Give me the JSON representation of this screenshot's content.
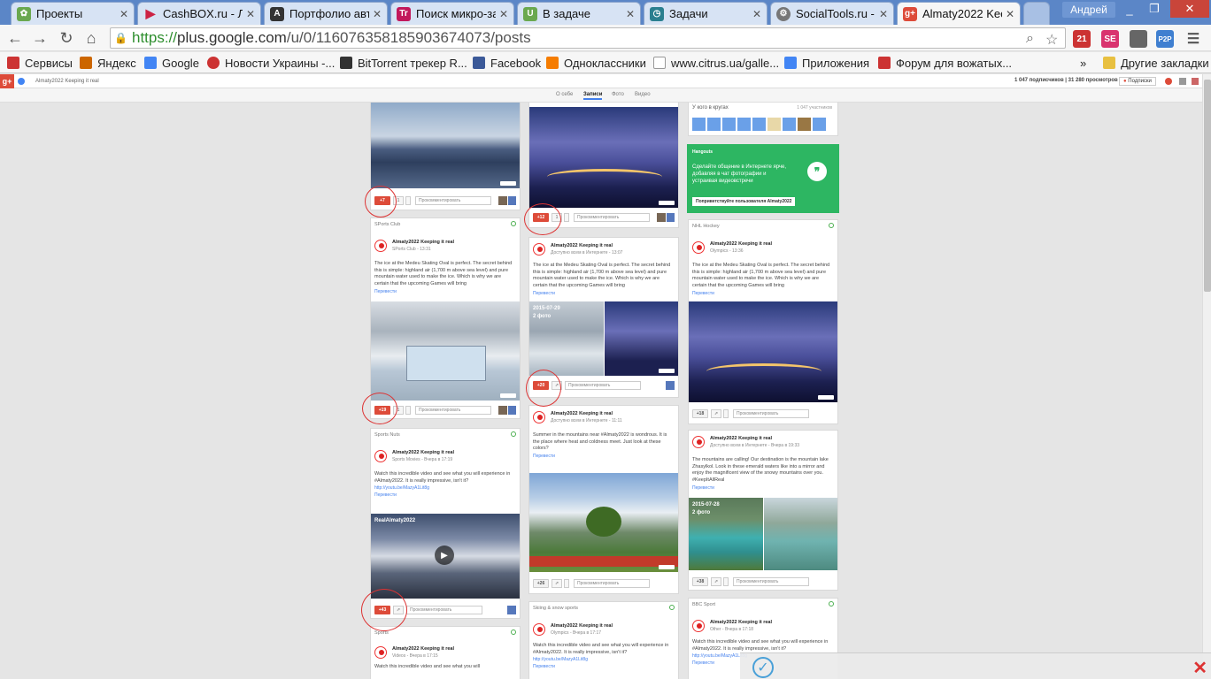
{
  "tabs": [
    {
      "title": "Проекты",
      "icon": "projects-icon",
      "color": "#6aa84f"
    },
    {
      "title": "CashBOX.ru - Ли",
      "icon": "cashbox-icon",
      "color": "#cc2244"
    },
    {
      "title": "Портфолио авто",
      "icon": "portfolio-icon",
      "color": "#333333"
    },
    {
      "title": "Поиск микро-за",
      "icon": "search-micro-icon",
      "color": "#c2185b"
    },
    {
      "title": "В задаче",
      "icon": "task-icon",
      "color": "#6aa84f"
    },
    {
      "title": "Задачи",
      "icon": "tasks-icon",
      "color": "#2a7f8f"
    },
    {
      "title": "SocialTools.ru -",
      "icon": "socialtools-icon",
      "color": "#555555"
    },
    {
      "title": "Almaty2022 Kee",
      "icon": "gplus-icon",
      "color": "#dd4b39"
    }
  ],
  "window": {
    "user": "Андрей"
  },
  "address": {
    "scheme": "https://",
    "host": "plus.google.com",
    "path": "/u/0/116076358185903674073/posts"
  },
  "extensions": [
    {
      "label": "21",
      "color": "#cc3333"
    },
    {
      "label": "SE",
      "color": "#d9336f"
    },
    {
      "label": "",
      "color": "#666666"
    },
    {
      "label": "P2P",
      "color": "#3f7fd0"
    },
    {
      "label": "",
      "color": "#555555"
    }
  ],
  "bookmarks": [
    {
      "label": "Сервисы",
      "color": "#cc3333"
    },
    {
      "label": "Яндекс",
      "color": "#cc6600"
    },
    {
      "label": "Google",
      "color": "#4285f4"
    },
    {
      "label": "Новости Украины -...",
      "color": "#cc3333"
    },
    {
      "label": "BitTorrent трекер R...",
      "color": "#333333"
    },
    {
      "label": "Facebook",
      "color": "#3b5998"
    },
    {
      "label": "Одноклассники",
      "color": "#f57c00"
    },
    {
      "label": "www.citrus.ua/galle...",
      "color": "#dddddd"
    },
    {
      "label": "Приложения",
      "color": "#4285f4"
    },
    {
      "label": "Форум для вожатых...",
      "color": "#cc3333"
    }
  ],
  "bookmarks_more": "»",
  "bookmarks_other": "Другие закладки",
  "gbar": {
    "page_name": "Almaty2022 Keeping it real",
    "stats": "1 047 подписчиков | 31 280 просмотров",
    "follow_label": "Подписки"
  },
  "subnav": {
    "tabs": [
      "О себе",
      "Записи",
      "Фото",
      "Видео"
    ],
    "active": 1
  },
  "columns": {
    "left": {
      "top_card": {
        "plus": "+7",
        "comment_ph": "Прокомментировать"
      },
      "card2": {
        "community": "SPorts Club",
        "author": "Almaty2022 Keeping it real",
        "meta": "SPorts Club  -  13:31",
        "text": "The ice at the Medeu Skating Oval is perfect. The secret behind this is simple: highland air (1,700 m above sea level) and pure mountain water used to make the ice. Which is why we are certain that the upcoming Games will bring",
        "translate": "Перевести",
        "plus": "+19",
        "comment_ph": "Прокомментировать"
      },
      "card3": {
        "community": "Sports Nuts",
        "author": "Almaty2022 Keeping it real",
        "meta": "Sports Movies  -  Вчера в 17:19",
        "text": "Watch this incredible video and see what you will experience in #Almaty2022. It is really impressive, isn't it?",
        "link": "http://youtu.be/MazyA1Lit8g",
        "translate": "Перевести",
        "video_title": "RealAlmaty2022",
        "plus": "+43",
        "comment_ph": "Прокомментировать"
      },
      "card4": {
        "community": "Sports",
        "author": "Almaty2022 Keeping it real",
        "meta": "Videos  -  Вчера в 17:15",
        "text": "Watch this incredible video and see what you will"
      }
    },
    "middle": {
      "top_card": {
        "plus": "+12",
        "comment_ph": "Прокомментировать"
      },
      "card2": {
        "author": "Almaty2022 Keeping it real",
        "meta": "Доступно всем в Интернете  -  13:07",
        "text": "The ice at the Medeu Skating Oval is perfect. The secret behind this is simple: highland air (1,700 m above sea level) and pure mountain water used to make the ice. Which is why we are certain that the upcoming Games will bring",
        "translate": "Перевести",
        "album_date": "2015-07-29",
        "album_count": "2 фото",
        "plus": "+20",
        "comment_ph": "Прокомментировать"
      },
      "card3": {
        "author": "Almaty2022 Keeping it real",
        "meta": "Доступно всем в Интернете  -  11:11",
        "text": "Summer in the mountains near #Almaty2022 is wondrous. It is the place where heat and coldness meet. Just look at these colors?",
        "translate": "Перевести",
        "plus": "+26",
        "comment_ph": "Прокомментировать"
      },
      "card4": {
        "community": "Skiing & snow sports",
        "author": "Almaty2022 Keeping it real",
        "meta": "Olympics  -  Вчера в 17:17",
        "text": "Watch this incredible video and see what you will experience in #Almaty2022. It is really impressive, isn't it?",
        "link": "http://youtu.be/MazyA1Lit8g",
        "translate": "Перевести"
      }
    },
    "right": {
      "circles": {
        "title": "У кого в кругах",
        "count": "1 047 участников"
      },
      "hangouts": {
        "title": "Hangouts",
        "text": "Сделайте общение в Интернете ярче, добавляя в чат фотографии и устраивая видеовстречи",
        "button": "Поприветствуйте пользователя Almaty2022"
      },
      "card2": {
        "community": "NHL Hockey",
        "author": "Almaty2022 Keeping it real",
        "meta": "Olympics  -  13:36",
        "text": "The ice at the Medeu Skating Oval is perfect. The secret behind this is simple: highland air (1,700 m above sea level) and pure mountain water used to make the ice. Which is why we are certain that the upcoming Games will bring",
        "translate": "Перевести",
        "plus": "+18",
        "comment_ph": "Прокомментировать"
      },
      "card3": {
        "author": "Almaty2022 Keeping it real",
        "meta": "Доступно всем в Интернете  -  Вчера в 19:33",
        "text": "The mountains are calling! Our destination is the mountain lake Zhasylkol. Look in these emerald waters like into a mirror and enjoy the magnificent view of the snowy mountains over you. #KeepItAllReal",
        "translate": "Перевести",
        "album_date": "2015-07-28",
        "album_count": "2 фото",
        "plus": "+38",
        "comment_ph": "Прокомментировать"
      },
      "card4": {
        "community": "BBC Sport",
        "author": "Almaty2022 Keeping it real",
        "meta": "Other  -  Вчера в 17:18",
        "text": "Watch this incredible video and see what you will experience in #Almaty2022. It is really impressive, isn't it?",
        "link": "http://youtu.be/MazyA1Lit8g",
        "translate": "Перевести"
      }
    }
  }
}
